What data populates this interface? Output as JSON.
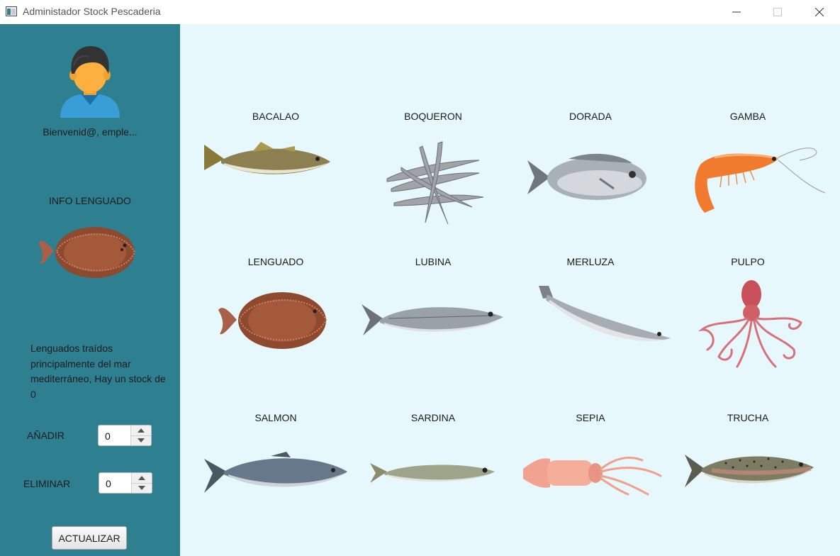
{
  "window": {
    "title": "Administador Stock Pescaderia"
  },
  "sidebar": {
    "welcome": "Bienvenid@, emple...",
    "info_title": "INFO LENGUADO",
    "description": "Lenguados traídos principalmente del mar mediterráneo, Hay un stock de 0",
    "add_label": "AÑADIR",
    "add_value": "0",
    "delete_label": "ELIMINAR",
    "delete_value": "0",
    "update_button": "ACTUALIZAR"
  },
  "products": [
    {
      "name": "BACALAO"
    },
    {
      "name": "BOQUERON"
    },
    {
      "name": "DORADA"
    },
    {
      "name": "GAMBA"
    },
    {
      "name": "LENGUADO"
    },
    {
      "name": "LUBINA"
    },
    {
      "name": "MERLUZA"
    },
    {
      "name": "PULPO"
    },
    {
      "name": "SALMON"
    },
    {
      "name": "SARDINA"
    },
    {
      "name": "SEPIA"
    },
    {
      "name": "TRUCHA"
    }
  ],
  "colors": {
    "sidebar": "#2e8091",
    "main_bg": "#e6f8fc"
  }
}
